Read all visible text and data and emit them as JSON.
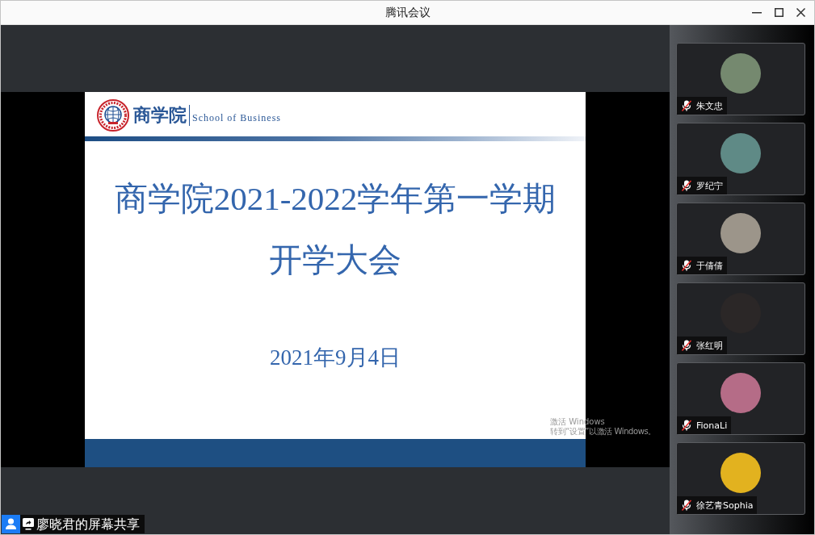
{
  "window": {
    "title": "腾讯会议"
  },
  "shared_screen": {
    "presenter_label": "廖晓君的屏幕共享",
    "slide": {
      "header_title": "商学院",
      "header_subtitle": "School of Business",
      "title_lines": [
        "商学院2021-2022学年第一学期",
        "开学大会"
      ],
      "date": "2021年9月4日"
    },
    "os_notice": {
      "title": "激活 Windows",
      "text": "转到“设置”以激活 Windows。"
    }
  },
  "participants": [
    {
      "name": "朱文忠",
      "muted": true,
      "color": "#75896f"
    },
    {
      "name": "罗纪宁",
      "muted": true,
      "color": "#5f8a86"
    },
    {
      "name": "于倩倩",
      "muted": true,
      "color": "#9c958a"
    },
    {
      "name": "张红明",
      "muted": true,
      "color": "#2b2727"
    },
    {
      "name": "FionaLi",
      "muted": true,
      "color": "#b56c87"
    },
    {
      "name": "徐艺青Sophia",
      "muted": true,
      "color": "#e2b21f"
    }
  ]
}
